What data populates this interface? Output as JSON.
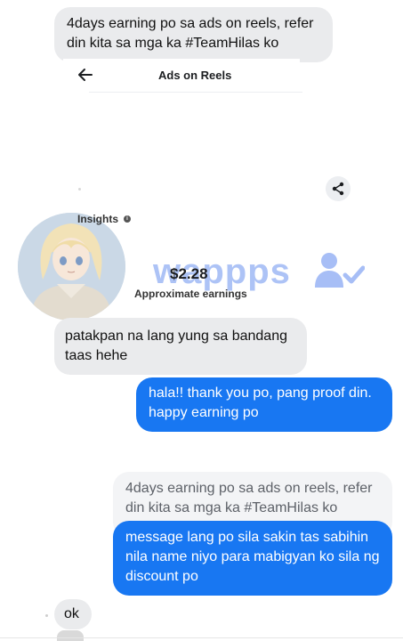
{
  "conversation": {
    "message_1": "4days earning po sa ads on reels, refer din kita sa mga ka #TeamHilas ko",
    "screenshot": {
      "title": "Ads on Reels",
      "insights_label": "Insights",
      "earnings_value": "$2.28",
      "earnings_label": "Approximate earnings"
    },
    "message_2": "patakpan na lang yung sa bandang taas hehe",
    "message_3": "hala!! thank you po, pang proof din. happy earning po",
    "quoted_reply": "4days earning po sa ads on reels, refer din kita sa mga ka #TeamHilas ko",
    "message_4": "message lang po sila sakin tas sabihin nila name niyo para mabigyan ko sila ng discount po",
    "message_5": "ok"
  },
  "watermark": "wappps",
  "icons": {
    "back": "back-arrow-icon",
    "share": "share-icon",
    "info": "info-icon",
    "watermark": "user-check-icon"
  },
  "colors": {
    "outgoing_bubble": "#1877f2",
    "incoming_bubble": "#eaebed",
    "watermark": "#a7bef6"
  }
}
